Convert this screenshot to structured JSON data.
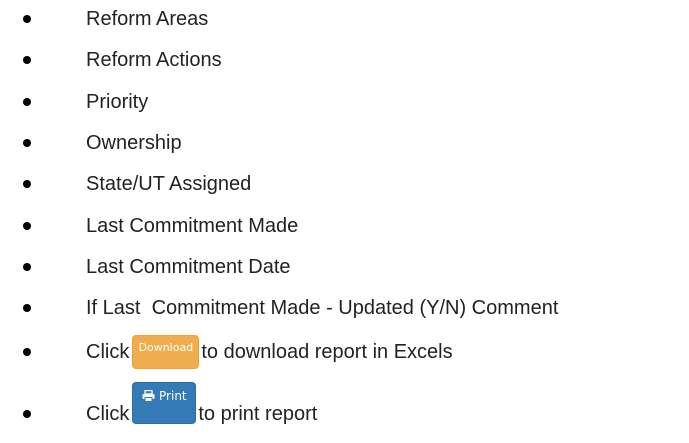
{
  "items": [
    {
      "text": "Reform Areas"
    },
    {
      "text": "Reform Actions"
    },
    {
      "text": "Priority"
    },
    {
      "text": "Ownership"
    },
    {
      "text": "State/UT Assigned"
    },
    {
      "text": "Last Commitment Made"
    },
    {
      "text": "Last Commitment Date"
    },
    {
      "text": "If Last  Commitment Made - Updated (Y/N) Comment"
    }
  ],
  "download_row": {
    "prefix": "Click",
    "button_label": "Download",
    "suffix": "to download report in Excels"
  },
  "print_row": {
    "prefix": "Click",
    "button_label": "Print",
    "button_icon": "printer-icon",
    "suffix": "to print report"
  },
  "colors": {
    "download_button": "#f0ad4e",
    "print_button": "#337ab7",
    "bullet": "#000000",
    "text": "#222222"
  }
}
